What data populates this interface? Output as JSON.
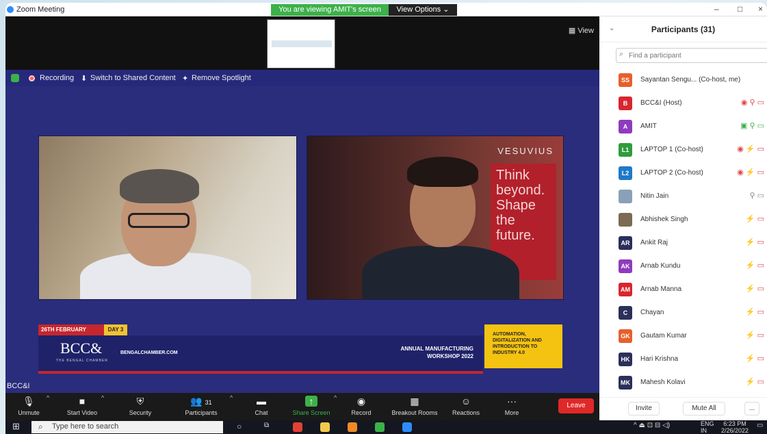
{
  "window": {
    "title": "Zoom Meeting",
    "viewing_banner": "You are viewing AMIT's screen",
    "view_options": "View Options ⌄",
    "minimize": "–",
    "restore": "□",
    "close": "×"
  },
  "shared_strip": {
    "view_label": "View"
  },
  "stage_bar": {
    "recording": "Recording",
    "switch": "Switch to Shared Content",
    "remove_spotlight": "Remove Spotlight"
  },
  "videos": {
    "left_label": "BCC&I",
    "right_brand": "VESUVIUS",
    "tagline": "Think beyond. Shape the future."
  },
  "banner": {
    "date": "26TH FEBRUARY",
    "day": "DAY 3",
    "logo": "BCC&",
    "logo_sub": "THE BENGAL CHAMBER",
    "website": "BENGALCHAMBER.COM",
    "workshop_line1": "ANNUAL MANUFACTURING",
    "workshop_line2": "WORKSHOP 2022",
    "yellow_text": "AUTOMATION, DIGITALIZATION AND INTRODUCTION TO INDUSTRY 4.0"
  },
  "name_tag": "BCC&I",
  "toolbar": {
    "items": [
      {
        "label": "Unmute",
        "icon": "mic-muted-icon"
      },
      {
        "label": "Start Video",
        "icon": "video-off-icon"
      },
      {
        "label": "Security",
        "icon": "shield-icon"
      },
      {
        "label": "Participants",
        "icon": "participants-icon",
        "count": "31"
      },
      {
        "label": "Chat",
        "icon": "chat-icon"
      },
      {
        "label": "Share Screen",
        "icon": "share-screen-icon"
      },
      {
        "label": "Record",
        "icon": "record-icon"
      },
      {
        "label": "Breakout Rooms",
        "icon": "breakout-icon"
      },
      {
        "label": "Reactions",
        "icon": "reactions-icon"
      },
      {
        "label": "More",
        "icon": "more-icon"
      }
    ],
    "leave": "Leave"
  },
  "participants_panel": {
    "title": "Participants (31)",
    "search_placeholder": "Find a participant",
    "participants": [
      {
        "initials": "SS",
        "name": "Sayantan Sengu... (Co-host, me)",
        "color": "#e5602c",
        "status": "⚡ ▭"
      },
      {
        "initials": "B",
        "name": "BCC&I (Host)",
        "color": "#d8262f",
        "status": "◉ ⚲ ▭"
      },
      {
        "initials": "A",
        "name": "AMIT",
        "color": "#8e3bbf",
        "status": "▣ ⚲ ▭"
      },
      {
        "initials": "L1",
        "name": "LAPTOP 1 (Co-host)",
        "color": "#2f9c3d",
        "status": "◉ ⚡ ▭"
      },
      {
        "initials": "L2",
        "name": "LAPTOP 2 (Co-host)",
        "color": "#1f79c8",
        "status": "◉ ⚡ ▭"
      },
      {
        "initials": "",
        "name": "Nitin Jain",
        "color": "#8aa0b8",
        "status": "⚲ ▭"
      },
      {
        "initials": "",
        "name": "Abhishek Singh",
        "color": "#7c6a52",
        "status": "⚡ ▭"
      },
      {
        "initials": "AR",
        "name": "Ankit Raj",
        "color": "#2b2f5a",
        "status": "⚡ ▭"
      },
      {
        "initials": "AK",
        "name": "Arnab Kundu",
        "color": "#8e3bbf",
        "status": "⚡ ▭"
      },
      {
        "initials": "AM",
        "name": "Arnab Manna",
        "color": "#d8262f",
        "status": "⚡ ▭"
      },
      {
        "initials": "C",
        "name": "Chayan",
        "color": "#2b2f5a",
        "status": "⚡ ▭"
      },
      {
        "initials": "GK",
        "name": "Gautam Kumar",
        "color": "#e5602c",
        "status": "⚡ ▭"
      },
      {
        "initials": "HK",
        "name": "Hari Krishna",
        "color": "#2b2f5a",
        "status": "⚡ ▭"
      },
      {
        "initials": "MK",
        "name": "Mahesh Kolavi",
        "color": "#2b2f5a",
        "status": "⚡ ▭"
      }
    ],
    "invite": "Invite",
    "mute_all": "Mute All",
    "more": "..."
  },
  "taskbar": {
    "search_placeholder": "Type here to search",
    "lang": "ENG",
    "lang_sub": "IN",
    "time": "6:23 PM",
    "date": "2/26/2022"
  }
}
